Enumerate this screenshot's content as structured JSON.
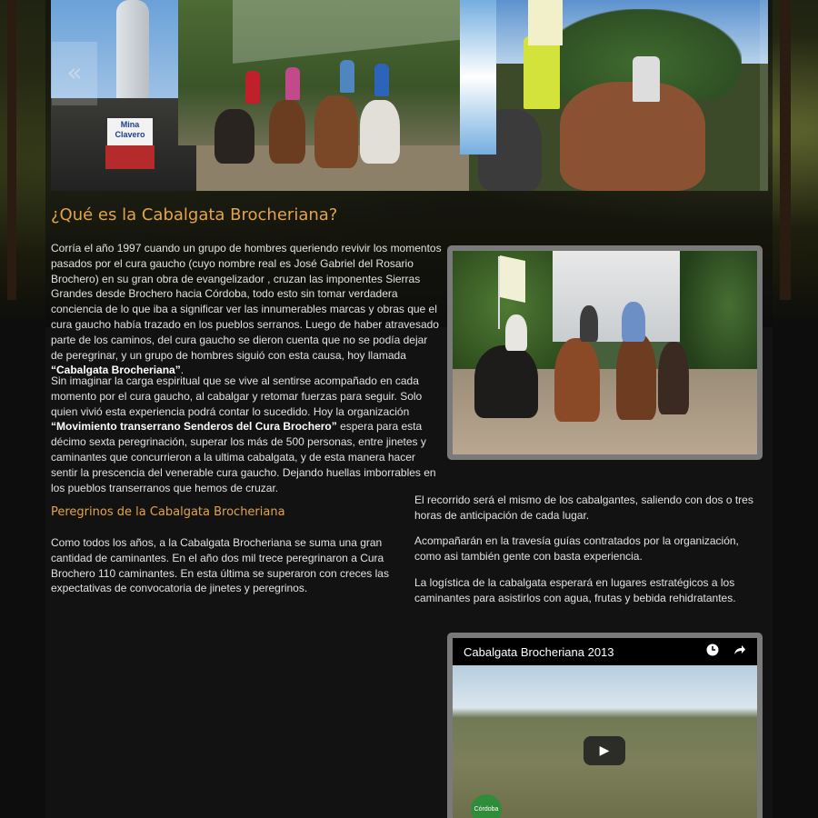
{
  "slider": {
    "prev_arrow": "«",
    "sign_text": "Mina Clavero"
  },
  "intro": {
    "title": "¿Qué es la Cabalgata Brocheriana?",
    "p1_a": "Corría el año 1997 cuando un grupo de hombres queriendo revivir los momentos pasados por el cura gaucho (cuyo nombre real es José Gabriel del Rosario Brochero) en su gran obra de evangelizador , cruzan las imponentes Sierras Grandes desde Brochero hacia Córdoba, todo esto sin tomar verdadera conciencia de lo que iba a significar ver las innumerables marcas y obras que el cura gaucho había trazado en los pueblos serranos. Luego de haber atravesado parte de los caminos, del cura gaucho se dieron cuenta que no se podía dejar de peregrinar, y un grupo de hombres siguió con esta causa, hoy llamada ",
    "p1_bold": "“Cabalgata Brocheriana”",
    "p1_b": ".",
    "p2_a": "Sin imaginar la carga espiritual que se vive al sentirse acompañado en cada momento por el cura gaucho, al cabalgar y retomar fuerzas para seguir. Solo quien vivió esta experiencia podrá contar lo sucedido. Hoy la organización ",
    "p2_bold": "“Movimiento transerrano Senderos del Cura Brochero”",
    "p2_b": " espera para esta décimo sexta peregrinación, superar los más de 500 personas, entre jinetes y caminantes que concurrieron a la ultima cabalgata, y de esta manera hacer sentir la prescencia del venerable cura gaucho. Dejando huellas imborrables en los pueblos transerranos que hemos de cruzar."
  },
  "pilgrims": {
    "title": "Peregrinos de la Cabalgata Brocheriana",
    "p1": "Como todos los años, a la Cabalgata Brocheriana se suma una gran cantidad de caminantes. En el año dos mil trece peregrinaron a Cura Brochero 110 caminantes. En esta última se superaron con creces las expectativas de convocatoria de jinetes y peregrinos.",
    "r1": "El recorrido será el mismo de los cabalgantes, saliendo con dos o tres horas de anticipación de cada lugar.",
    "r2": "Acompañarán en la travesía guías contratados por la organización, como asi también gente con basta experiencia.",
    "r3": "La logística de la cabalgata esperará en lugares estratégicos a los caminantes para asistirlos con agua, frutas y bebida rehidratantes."
  },
  "video": {
    "title": "Cabalgata Brocheriana 2013",
    "clock_icon": "clock-icon",
    "share_icon": "share-icon",
    "play_icon": "play-icon",
    "logo_text": "Córdoba"
  },
  "colors": {
    "accent": "#e3a34a",
    "body_text": "#e2e2e2",
    "background": "#0d0d0d",
    "frame": "#7a7a7a"
  }
}
